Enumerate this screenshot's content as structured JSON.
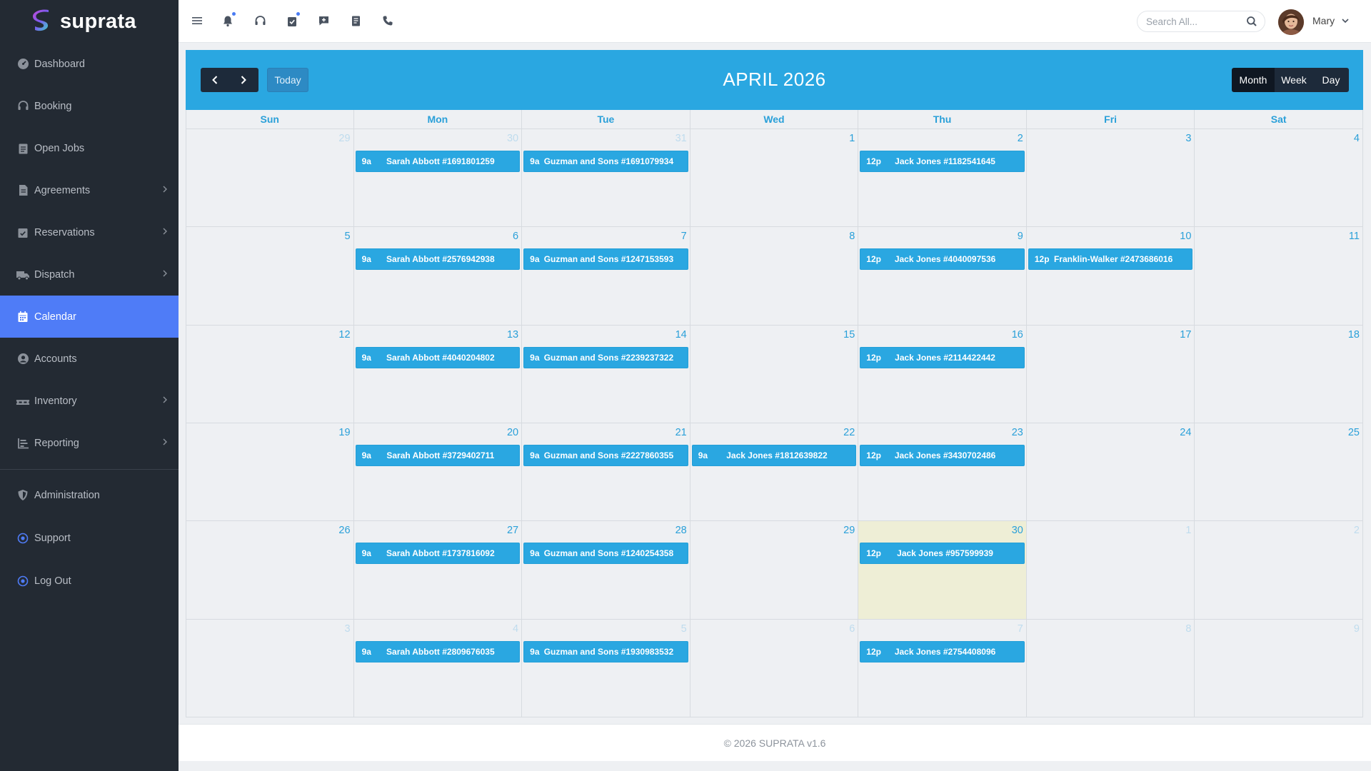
{
  "brand": {
    "name": "suprata"
  },
  "sidebar": {
    "items": [
      {
        "label": "Dashboard",
        "icon": "dashboard-icon",
        "has_submenu": false
      },
      {
        "label": "Booking",
        "icon": "headset-icon",
        "has_submenu": false
      },
      {
        "label": "Open Jobs",
        "icon": "clipboard-icon",
        "has_submenu": false
      },
      {
        "label": "Agreements",
        "icon": "document-icon",
        "has_submenu": true
      },
      {
        "label": "Reservations",
        "icon": "calendar-check-icon",
        "has_submenu": true
      },
      {
        "label": "Dispatch",
        "icon": "truck-icon",
        "has_submenu": true
      },
      {
        "label": "Calendar",
        "icon": "calendar-icon",
        "has_submenu": false,
        "active": true
      },
      {
        "label": "Accounts",
        "icon": "user-circle-icon",
        "has_submenu": false
      },
      {
        "label": "Inventory",
        "icon": "pallet-icon",
        "has_submenu": true
      },
      {
        "label": "Reporting",
        "icon": "chart-icon",
        "has_submenu": true
      },
      {
        "label": "Administration",
        "icon": "shield-icon",
        "has_submenu": false
      },
      {
        "label": "Support",
        "icon": "support-icon",
        "has_submenu": false
      },
      {
        "label": "Log Out",
        "icon": "logout-icon",
        "has_submenu": false
      }
    ]
  },
  "topbar": {
    "icons": [
      "menu-icon",
      "bell-icon",
      "headset-icon",
      "clipboard-check-icon",
      "message-plus-icon",
      "receipt-icon",
      "phone-icon"
    ],
    "search_placeholder": "Search All...",
    "user_name": "Mary"
  },
  "calendar": {
    "title": "APRIL 2026",
    "today_label": "Today",
    "views": [
      "Month",
      "Week",
      "Day"
    ],
    "active_view": "Month",
    "weekdays": [
      "Sun",
      "Mon",
      "Tue",
      "Wed",
      "Thu",
      "Fri",
      "Sat"
    ],
    "weeks": [
      [
        {
          "day": "29",
          "other": true
        },
        {
          "day": "30",
          "other": true,
          "event": {
            "time": "9a",
            "title": "Sarah Abbott #1691801259"
          }
        },
        {
          "day": "31",
          "other": true,
          "event": {
            "time": "9a",
            "title": "Guzman and Sons #1691079934"
          }
        },
        {
          "day": "1"
        },
        {
          "day": "2",
          "event": {
            "time": "12p",
            "title": "Jack Jones #1182541645"
          }
        },
        {
          "day": "3"
        },
        {
          "day": "4"
        }
      ],
      [
        {
          "day": "5"
        },
        {
          "day": "6",
          "event": {
            "time": "9a",
            "title": "Sarah Abbott #2576942938"
          }
        },
        {
          "day": "7",
          "event": {
            "time": "9a",
            "title": "Guzman and Sons #1247153593"
          }
        },
        {
          "day": "8"
        },
        {
          "day": "9",
          "event": {
            "time": "12p",
            "title": "Jack Jones #4040097536"
          }
        },
        {
          "day": "10",
          "event": {
            "time": "12p",
            "title": "Franklin-Walker #2473686016"
          }
        },
        {
          "day": "11"
        }
      ],
      [
        {
          "day": "12"
        },
        {
          "day": "13",
          "event": {
            "time": "9a",
            "title": "Sarah Abbott #4040204802"
          }
        },
        {
          "day": "14",
          "event": {
            "time": "9a",
            "title": "Guzman and Sons #2239237322"
          }
        },
        {
          "day": "15"
        },
        {
          "day": "16",
          "event": {
            "time": "12p",
            "title": "Jack Jones #2114422442"
          }
        },
        {
          "day": "17"
        },
        {
          "day": "18"
        }
      ],
      [
        {
          "day": "19"
        },
        {
          "day": "20",
          "event": {
            "time": "9a",
            "title": "Sarah Abbott #3729402711"
          }
        },
        {
          "day": "21",
          "event": {
            "time": "9a",
            "title": "Guzman and Sons #2227860355"
          }
        },
        {
          "day": "22",
          "event": {
            "time": "9a",
            "title": "Jack Jones #1812639822"
          }
        },
        {
          "day": "23",
          "event": {
            "time": "12p",
            "title": "Jack Jones #3430702486"
          }
        },
        {
          "day": "24"
        },
        {
          "day": "25"
        }
      ],
      [
        {
          "day": "26"
        },
        {
          "day": "27",
          "event": {
            "time": "9a",
            "title": "Sarah Abbott #1737816092"
          }
        },
        {
          "day": "28",
          "event": {
            "time": "9a",
            "title": "Guzman and Sons #1240254358"
          }
        },
        {
          "day": "29"
        },
        {
          "day": "30",
          "today": true,
          "event": {
            "time": "12p",
            "title": "Jack Jones #957599939"
          }
        },
        {
          "day": "1",
          "other": true
        },
        {
          "day": "2",
          "other": true
        }
      ],
      [
        {
          "day": "3",
          "other": true
        },
        {
          "day": "4",
          "other": true,
          "event": {
            "time": "9a",
            "title": "Sarah Abbott #2809676035"
          }
        },
        {
          "day": "5",
          "other": true,
          "event": {
            "time": "9a",
            "title": "Guzman and Sons #1930983532"
          }
        },
        {
          "day": "6",
          "other": true
        },
        {
          "day": "7",
          "other": true,
          "event": {
            "time": "12p",
            "title": "Jack Jones #2754408096"
          }
        },
        {
          "day": "8",
          "other": true
        },
        {
          "day": "9",
          "other": true
        }
      ]
    ]
  },
  "footer": {
    "text": "© 2026 SUPRATA v1.6"
  },
  "colors": {
    "accent": "#2aa7e1",
    "sidebar_bg": "#232a33",
    "active_nav": "#4f7cf7",
    "today_bg": "#eeeed6"
  }
}
